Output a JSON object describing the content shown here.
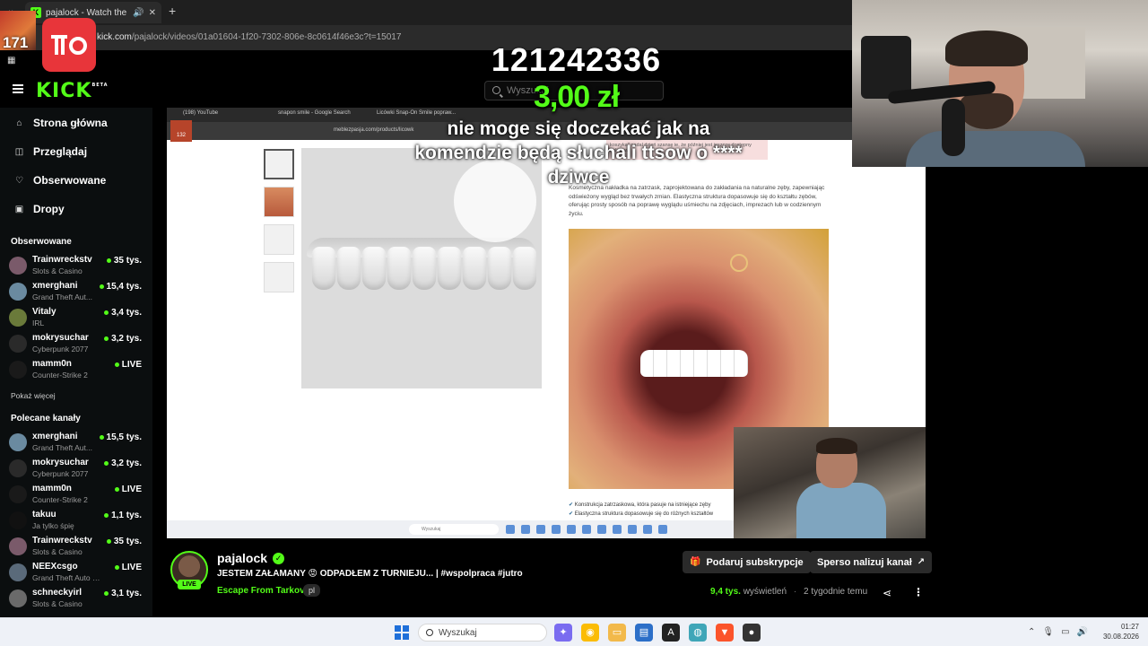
{
  "browser": {
    "tab_title": "pajalock - Watch the VOD o",
    "url_prefix": "kick.com",
    "url_path": "/pajalock/videos/01a01604-1f20-7302-806e-8c0614f46e3c?t=15017"
  },
  "overlay": {
    "avatar_number": "171",
    "donation_number": "121242336",
    "donation_amount": "3,00 zł",
    "donation_message": "nie moge się doczekać jak na komendzie będą słuchali ttsow o **** dziwce"
  },
  "kick": {
    "logo": "KICK",
    "logo_badge": "BETA",
    "search_placeholder": "Wyszukaj"
  },
  "sidebar": {
    "nav": [
      {
        "label": "Strona główna",
        "icon": "home-icon"
      },
      {
        "label": "Przeglądaj",
        "icon": "browse-icon"
      },
      {
        "label": "Obserwowane",
        "icon": "heart-icon"
      },
      {
        "label": "Dropy",
        "icon": "gift-icon"
      }
    ],
    "following_heading": "Obserwowane",
    "following": [
      {
        "name": "Trainwreckstv",
        "category": "Slots & Casino",
        "viewers": "35 tys."
      },
      {
        "name": "xmerghani",
        "category": "Grand Theft Aut...",
        "viewers": "15,4 tys."
      },
      {
        "name": "Vitaly",
        "category": "IRL",
        "viewers": "3,4 tys."
      },
      {
        "name": "mokrysuchar",
        "category": "Cyberpunk 2077",
        "viewers": "3,2 tys."
      },
      {
        "name": "mamm0n",
        "category": "Counter-Strike 2",
        "viewers": "LIVE"
      }
    ],
    "show_more": "Pokaż więcej",
    "recommended_heading": "Polecane kanały",
    "recommended": [
      {
        "name": "xmerghani",
        "category": "Grand Theft Aut...",
        "viewers": "15,5 tys."
      },
      {
        "name": "mokrysuchar",
        "category": "Cyberpunk 2077",
        "viewers": "3,2 tys."
      },
      {
        "name": "mamm0n",
        "category": "Counter-Strike 2",
        "viewers": "LIVE"
      },
      {
        "name": "takuu",
        "category": "Ja tylko śpię",
        "viewers": "1,1 tys."
      },
      {
        "name": "Trainwreckstv",
        "category": "Slots & Casino",
        "viewers": "35 tys."
      },
      {
        "name": "NEEXcsgo",
        "category": "Grand Theft Auto V (...",
        "viewers": "LIVE"
      },
      {
        "name": "schneckyirl",
        "category": "Slots & Casino",
        "viewers": "3,1 tys."
      }
    ]
  },
  "video": {
    "tabs": [
      "(198) YouTube",
      "snapon smile - Google Search",
      "Licówki Snap-On Smile popraw..."
    ],
    "inner_url": "meblezpasja.com/products/licowk",
    "inner_badge": "132",
    "notice_text": "koszyka\" nadal dzień szansę ie, że później jest jeszcze dostępny online w",
    "description": "Kosmetyczna nakładka na zatrzask, zaprojektowana do zakładania na naturalne zęby, zapewniając odświeżony wygląd bez trwałych zmian. Elastyczna struktura dopasowuje się do kształtu zębów, oferując prosty sposób na poprawę wyglądu uśmiechu na zdjęciach, imprezach lub w codziennym życiu.",
    "bullets": [
      "Konstrukcja zatrzaskowa, która pasuje na istniejące zęby",
      "Elastyczna struktura dopasowuje się do różnych kształtów"
    ],
    "taskbar_search": "Wyszukaj"
  },
  "stream": {
    "name": "pajalock",
    "live_label": "LIVE",
    "title": "JESTEM ZAŁAMANY 😡 ODPADŁEM Z TURNIEJU... | #wspolpraca #jutro",
    "category": "Escape From Tarkov",
    "language": "pl",
    "subscribe_label": "Podaruj subskrypcje",
    "sponsor_label": "Sperso nalizuj kanał",
    "views": "9,4 tys.",
    "views_label": "wyświetleń",
    "age": "2 tygodnie temu"
  },
  "taskbar": {
    "search_label": "Wyszukaj",
    "time": "01:27",
    "date": "30.08.2026"
  },
  "colors": {
    "kick_green": "#53fc18",
    "background": "#000000",
    "sidebar_bg": "#0b0e0f"
  }
}
